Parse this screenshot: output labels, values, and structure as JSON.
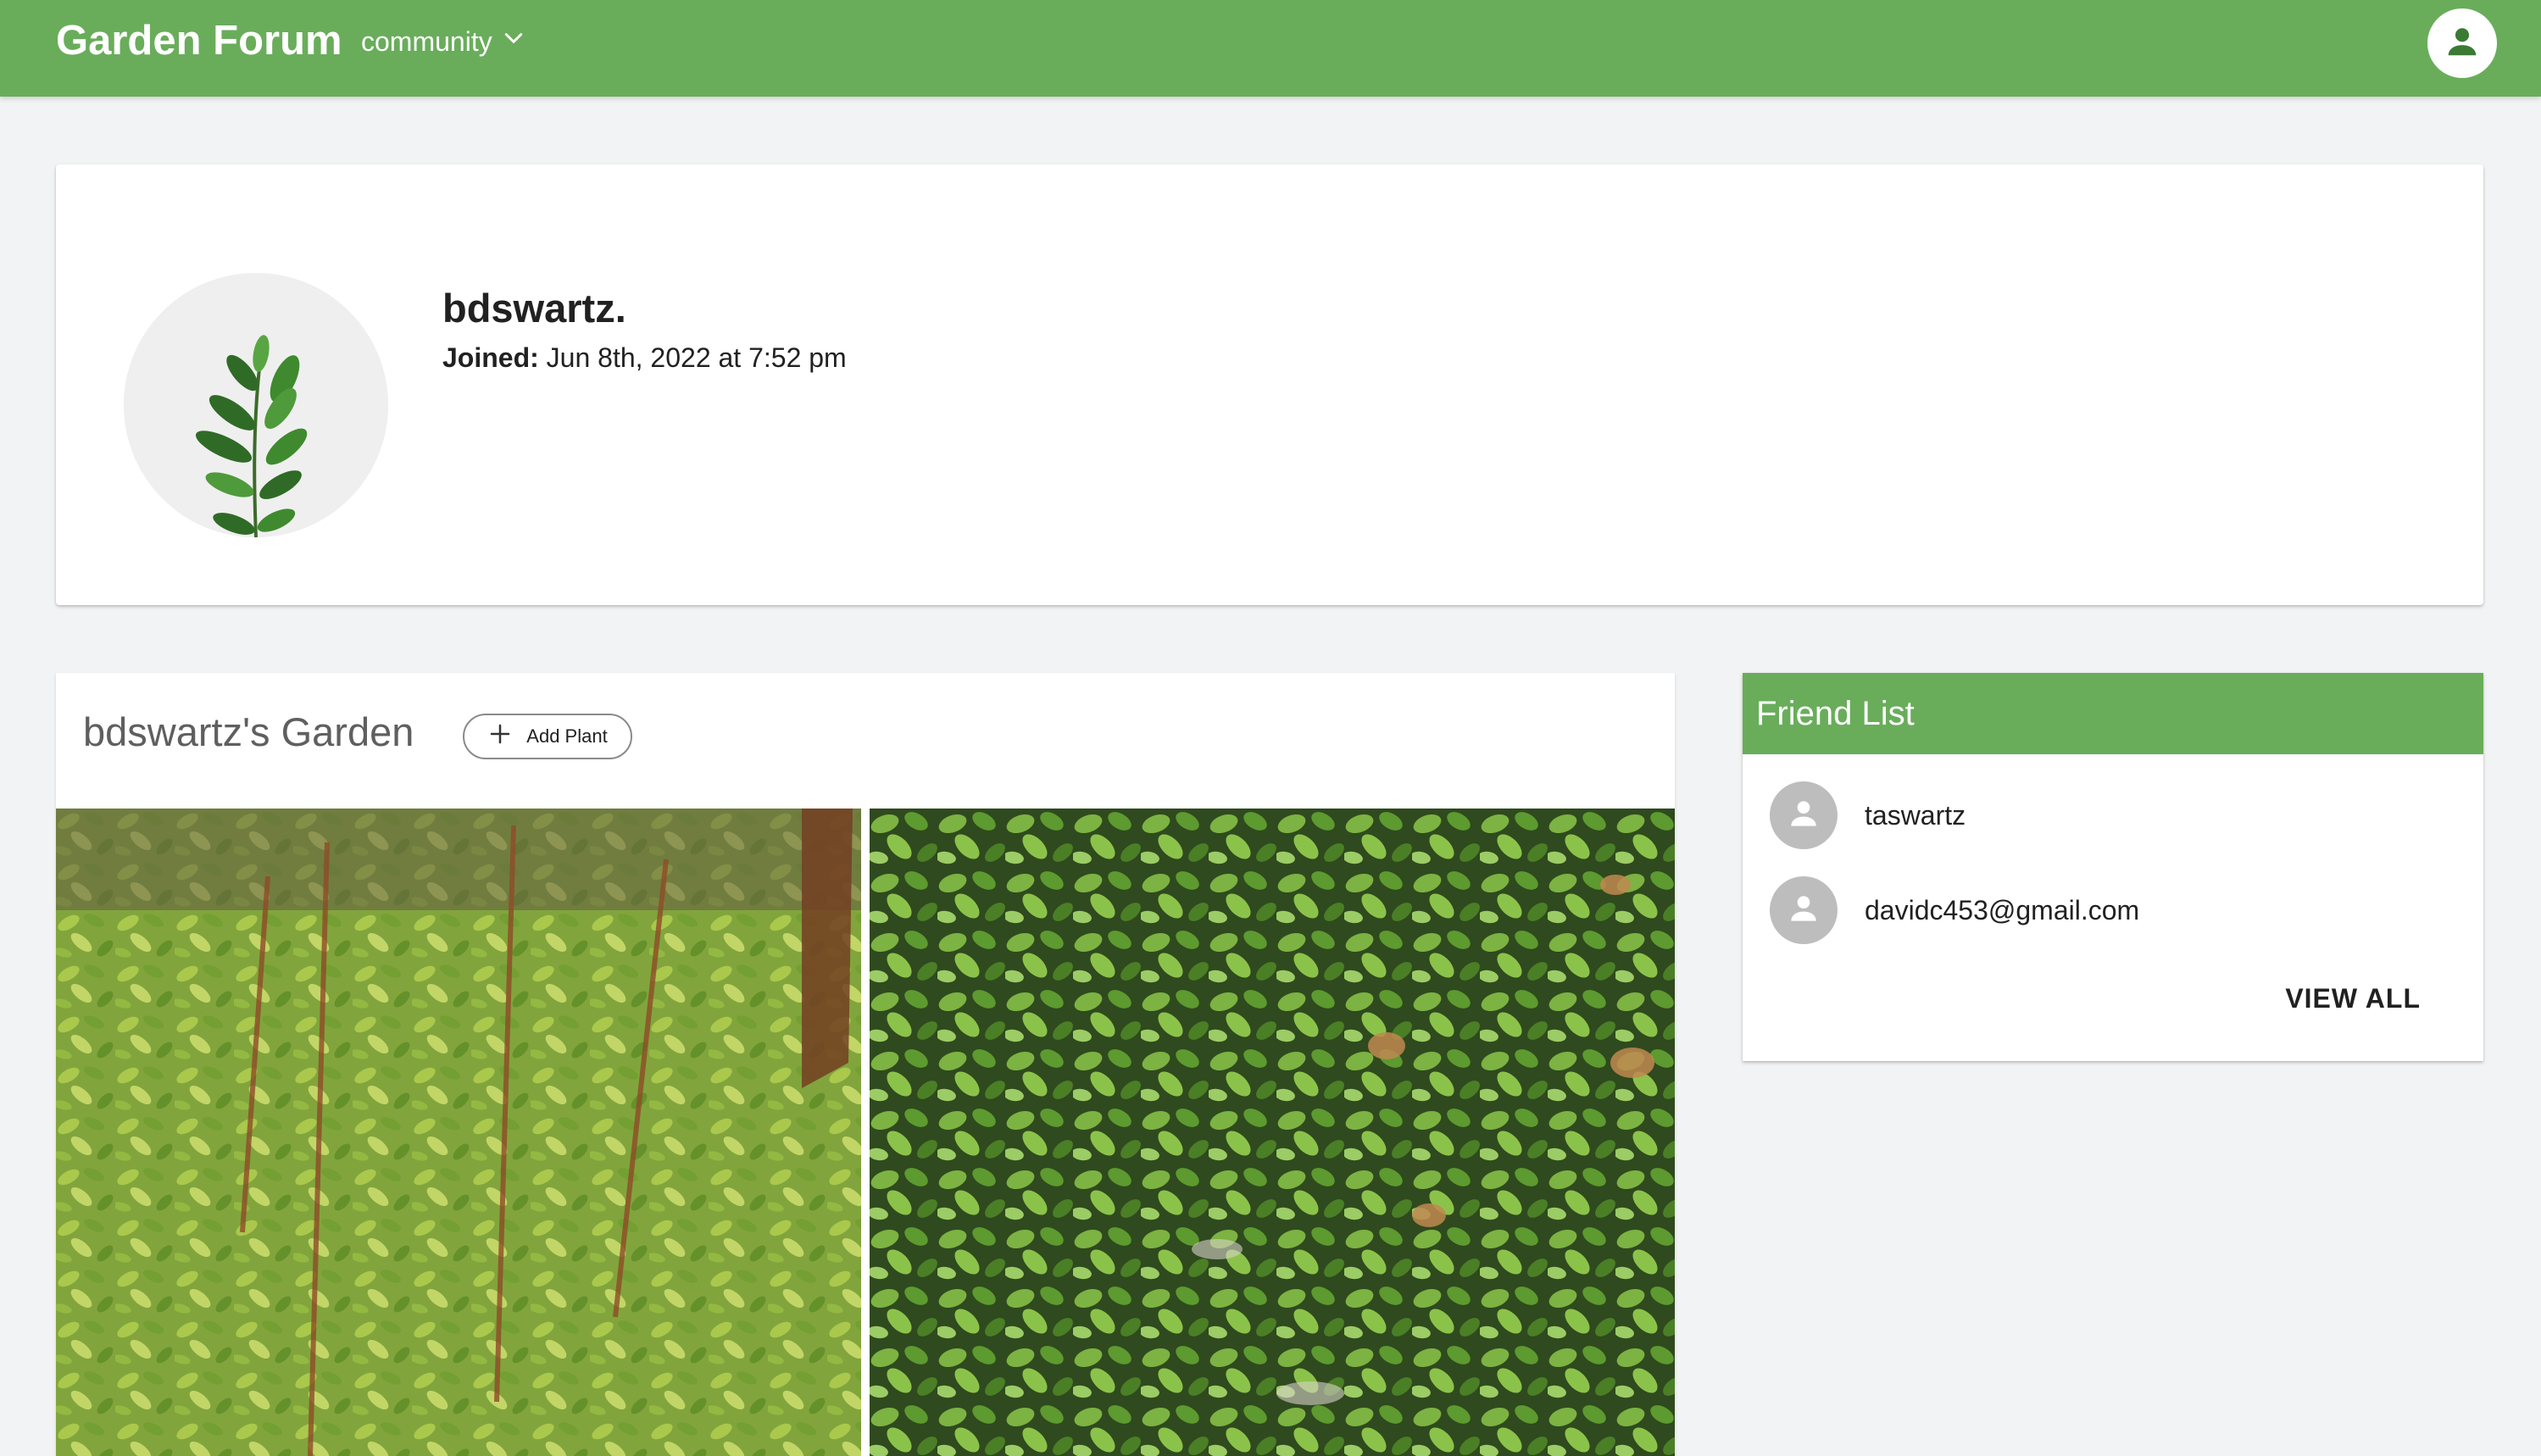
{
  "app": {
    "brand": "Garden Forum",
    "menu_label": "community"
  },
  "colors": {
    "primary": "#69ad5b",
    "background": "#f2f3f4"
  },
  "icons": {
    "menu_chevron": "chevron-down-icon",
    "account": "account-icon",
    "add": "plus-icon",
    "friend_avatar": "person-icon"
  },
  "profile": {
    "username": "bdswartz.",
    "joined_label": "Joined:",
    "joined_value": " Jun 8th, 2022 at 7:52 pm"
  },
  "garden": {
    "title": "bdswartz's Garden",
    "add_button_label": "Add Plant"
  },
  "friends": {
    "header": "Friend List",
    "items": [
      {
        "name": "taswartz"
      },
      {
        "name": "davidc453@gmail.com"
      }
    ],
    "view_all_label": "VIEW ALL"
  }
}
